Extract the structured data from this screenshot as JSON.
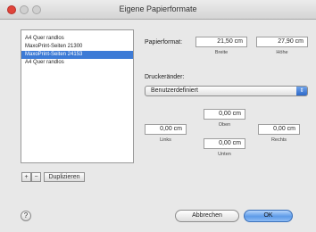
{
  "window": {
    "title": "Eigene Papierformate"
  },
  "list": {
    "items": [
      {
        "label": "A4 Quer randlos",
        "selected": false
      },
      {
        "label": "MaxoPrint-Seiten 21300",
        "selected": false
      },
      {
        "label": "MaxoPrint-Seiten 24153",
        "selected": true
      },
      {
        "label": "A4 Quer randlos",
        "selected": false
      }
    ]
  },
  "list_controls": {
    "add": "+",
    "remove": "−",
    "duplicate": "Duplizieren"
  },
  "paper": {
    "label": "Papierformat:",
    "width_value": "21,50 cm",
    "width_caption": "Breite",
    "height_value": "27,90 cm",
    "height_caption": "Höhe"
  },
  "margins": {
    "label": "Druckeränder:",
    "preset": "Benutzerdefiniert",
    "top": {
      "value": "0,00 cm",
      "caption": "Oben"
    },
    "left": {
      "value": "0,00 cm",
      "caption": "Links"
    },
    "bottom": {
      "value": "0,00 cm",
      "caption": "Unten"
    },
    "right": {
      "value": "0,00 cm",
      "caption": "Rechts"
    }
  },
  "footer": {
    "help": "?",
    "cancel": "Abbrechen",
    "ok": "OK"
  },
  "colors": {
    "selection": "#3d7bd6",
    "ok_button": "#5d9ae8",
    "close_button": "#e0443a"
  }
}
